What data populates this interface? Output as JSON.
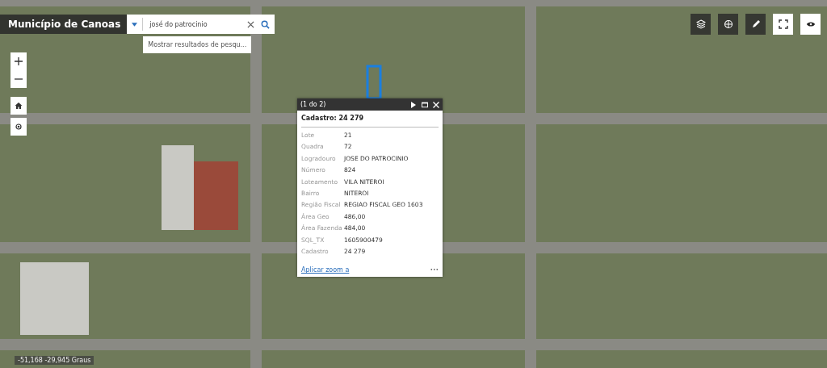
{
  "header": {
    "title": "Município de Canoas"
  },
  "search": {
    "value": "josé do patrocinio",
    "suggestion": "Mostrar resultados de pesqu..."
  },
  "popup": {
    "pager": "(1 do 2)",
    "title": "Cadastro: 24 279",
    "fields": [
      {
        "label": "Lote",
        "value": "21"
      },
      {
        "label": "Quadra",
        "value": "72"
      },
      {
        "label": "Logradouro",
        "value": "JOSE DO PATROCINIO"
      },
      {
        "label": "Número",
        "value": "824"
      },
      {
        "label": "Loteamento",
        "value": "VILA NITEROI"
      },
      {
        "label": "Bairro",
        "value": "NITEROI"
      },
      {
        "label": "Região Fiscal",
        "value": "REGIAO FISCAL GEO 1603"
      },
      {
        "label": "Área Geo",
        "value": "486,00"
      },
      {
        "label": "Área Fazenda",
        "value": "484,00"
      },
      {
        "label": "SQL_TX",
        "value": "1605900479"
      },
      {
        "label": "Cadastro",
        "value": "24 279"
      }
    ],
    "zoom_link": "Aplicar zoom a",
    "more": "•••"
  },
  "coordinates": "-51,168 -29,945 Graus"
}
